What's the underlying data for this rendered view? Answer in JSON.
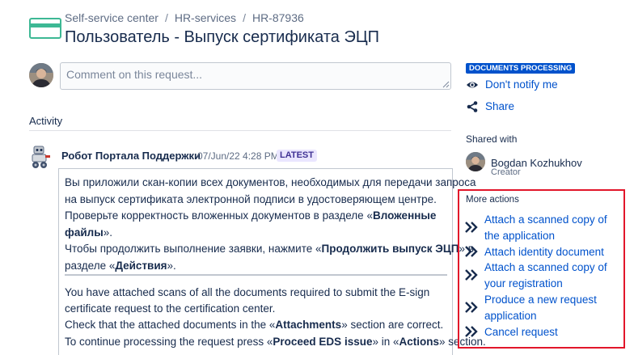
{
  "breadcrumb": {
    "items": [
      "Self-service center",
      "HR-services",
      "HR-87936"
    ],
    "separator": "/"
  },
  "page": {
    "title": "Пользователь - Выпуск сертификата ЭЦП"
  },
  "comment": {
    "placeholder": "Comment on this request..."
  },
  "activity": {
    "heading": "Activity"
  },
  "message": {
    "author": "Робот Портала Поддержки",
    "timestamp": "07/Jun/22 4:28 PM",
    "badge": "LATEST",
    "ru": {
      "l1": "Вы приложили скан-копии всех документов, необходимых для передачи запроса",
      "l2": "на выпуск сертификата электронной подписи в удостоверяющем центре.",
      "l3_pre": "Проверьте корректность вложенных документов в разделе «",
      "l3_bold": "Вложенные",
      "l4_bold": "файлы",
      "l4_post": "».",
      "l5_pre": "Чтобы продолжить выполнение заявки, нажмите «",
      "l5_bold": "Продолжить выпуск ЭЦП",
      "l5_post": "» в",
      "l6_pre": "разделе «",
      "l6_bold": "Действия",
      "l6_post": "»."
    },
    "en": {
      "l1": "You have attached scans of all the documents required to submit the E-sign",
      "l2": "certificate request to the certification center.",
      "l3_pre": "Check that the attached documents in the «",
      "l3_bold": "Attachments",
      "l3_post": "» section are correct.",
      "l4_pre": "To continue processing the request press «",
      "l4_bold": "Proceed EDS issue",
      "l4_mid": "» in «",
      "l4_bold2": "Actions",
      "l4_post": "» section."
    }
  },
  "sidebar": {
    "status": "DOCUMENTS PROCESSING",
    "notify_label": "Don't notify me",
    "share_label": "Share",
    "shared_with_heading": "Shared with",
    "shared_user": {
      "name": "Bogdan Kozhukhov",
      "role": "Creator"
    },
    "more_actions": {
      "heading": "More actions",
      "items": [
        {
          "label": "Attach a scanned copy of the application"
        },
        {
          "label": "Attach identity document"
        },
        {
          "label": "Attach a scanned copy of your registration"
        },
        {
          "label": "Produce a new request application"
        },
        {
          "label": "Cancel request"
        }
      ]
    }
  },
  "colors": {
    "link": "#0052cc",
    "status_badge": "#0052cc",
    "highlight_border": "#e2162a",
    "portal_icon": "#3db894",
    "latest_badge_bg": "#eae6ff",
    "latest_badge_text": "#403294"
  },
  "icons": {
    "portal": "portal-card-icon",
    "notify": "eye-icon",
    "share": "share-icon",
    "action": "double-chevron-right-icon"
  }
}
